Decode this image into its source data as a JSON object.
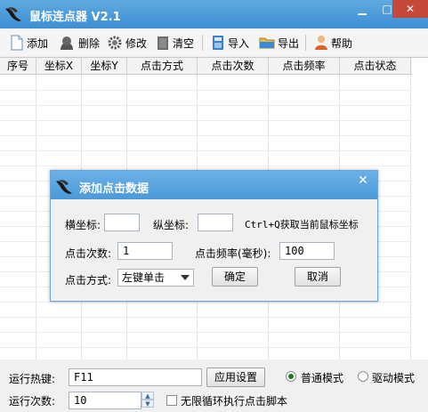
{
  "window": {
    "title": "鼠标连点器 V2.1"
  },
  "toolbar": {
    "add": "添加",
    "delete": "删除",
    "edit": "修改",
    "clear": "清空",
    "import": "导入",
    "export": "导出",
    "help": "帮助"
  },
  "table": {
    "columns": [
      "序号",
      "坐标X",
      "坐标Y",
      "点击方式",
      "点击次数",
      "点击频率",
      "点击状态"
    ]
  },
  "dialog": {
    "title": "添加点击数据",
    "x_label": "横坐标:",
    "x_value": "",
    "y_label": "纵坐标:",
    "y_value": "",
    "hint": "Ctrl+Q获取当前鼠标坐标",
    "count_label": "点击次数:",
    "count_value": "1",
    "freq_label": "点击频率(毫秒):",
    "freq_value": "100",
    "mode_label": "点击方式:",
    "mode_value": "左键单击",
    "ok": "确定",
    "cancel": "取消"
  },
  "bottom": {
    "hotkey_label": "运行热键:",
    "hotkey_value": "F11",
    "apply": "应用设置",
    "mode_normal": "普通模式",
    "mode_driver": "驱动模式",
    "selected_mode": "普通模式",
    "runs_label": "运行次数:",
    "runs_value": "10",
    "infinite_loop": "无限循环执行点击脚本",
    "infinite_checked": false
  }
}
